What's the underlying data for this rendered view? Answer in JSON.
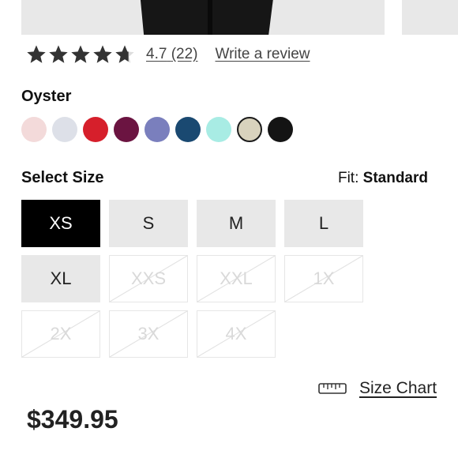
{
  "rating": {
    "stars": 4.7,
    "value": "4.7",
    "count": "(22)",
    "write_review": "Write a review"
  },
  "color": {
    "selected_name": "Oyster",
    "swatches": [
      "#f3dada",
      "#dde0e8",
      "#d61f2b",
      "#6b1441",
      "#7a7fbd",
      "#1a4971",
      "#a8ece4",
      "#d8d2bd",
      "#141414"
    ],
    "selected_index": 7
  },
  "size": {
    "title": "Select Size",
    "fit_label": "Fit:",
    "fit_value": "Standard",
    "options": [
      {
        "label": "XS",
        "state": "selected"
      },
      {
        "label": "S",
        "state": "available"
      },
      {
        "label": "M",
        "state": "available"
      },
      {
        "label": "L",
        "state": "available"
      },
      {
        "label": "XL",
        "state": "available"
      },
      {
        "label": "XXS",
        "state": "unavailable"
      },
      {
        "label": "XXL",
        "state": "unavailable"
      },
      {
        "label": "1X",
        "state": "unavailable"
      },
      {
        "label": "2X",
        "state": "unavailable"
      },
      {
        "label": "3X",
        "state": "unavailable"
      },
      {
        "label": "4X",
        "state": "unavailable"
      }
    ]
  },
  "size_chart": {
    "label": "Size Chart",
    "icon": "ruler-icon"
  },
  "price": "$349.95"
}
